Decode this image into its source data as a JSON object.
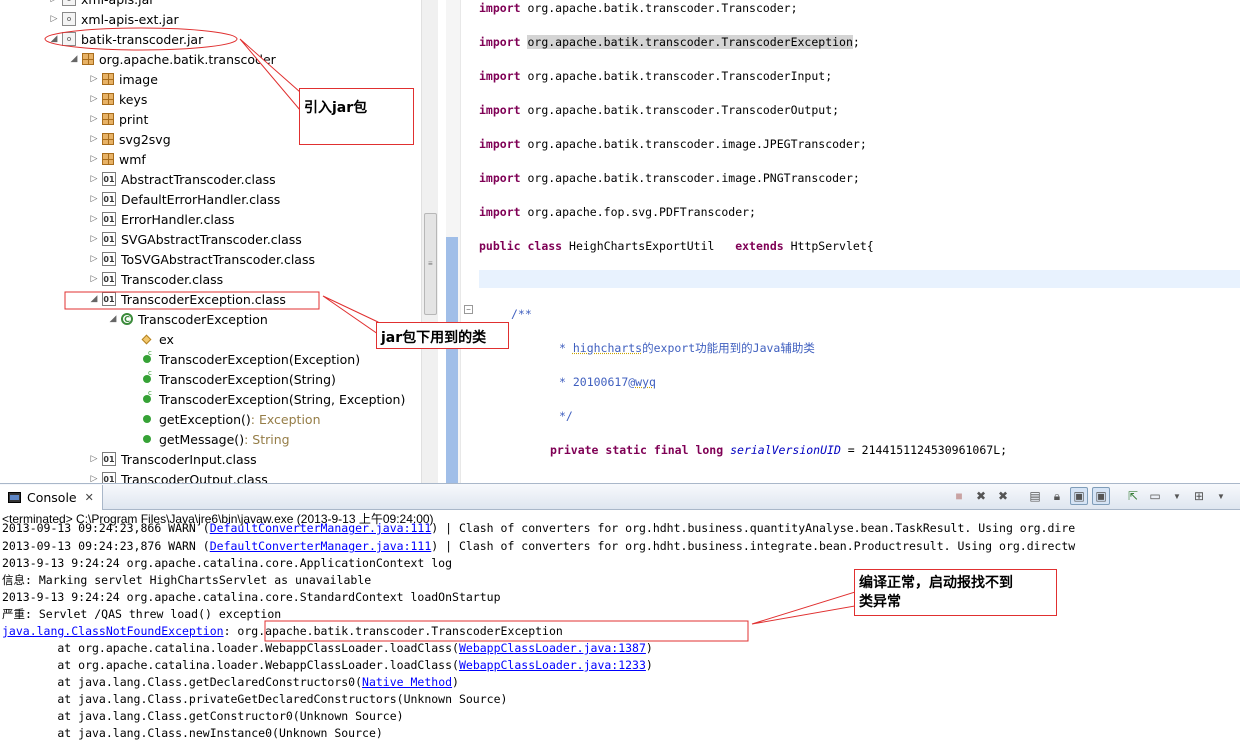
{
  "tree": {
    "items": [
      {
        "label": "xml-apis.jar",
        "icon": "jar-icon",
        "twisty": "▷"
      },
      {
        "label": "xml-apis-ext.jar",
        "icon": "jar-icon",
        "twisty": "▷"
      },
      {
        "label": "batik-transcoder.jar",
        "icon": "jar-icon",
        "twisty": "◢"
      },
      {
        "label": "org.apache.batik.transcoder",
        "icon": "package-icon",
        "twisty": "◢"
      },
      {
        "label": "image",
        "icon": "package-icon",
        "twisty": "▷"
      },
      {
        "label": "keys",
        "icon": "package-icon",
        "twisty": "▷"
      },
      {
        "label": "print",
        "icon": "package-icon",
        "twisty": "▷"
      },
      {
        "label": "svg2svg",
        "icon": "package-icon",
        "twisty": "▷"
      },
      {
        "label": "wmf",
        "icon": "package-icon",
        "twisty": "▷"
      },
      {
        "label": "AbstractTranscoder.class",
        "icon": "class-file-icon",
        "twisty": "▷"
      },
      {
        "label": "DefaultErrorHandler.class",
        "icon": "class-file-icon",
        "twisty": "▷"
      },
      {
        "label": "ErrorHandler.class",
        "icon": "class-file-icon",
        "twisty": "▷"
      },
      {
        "label": "SVGAbstractTranscoder.class",
        "icon": "class-file-icon",
        "twisty": "▷"
      },
      {
        "label": "ToSVGAbstractTranscoder.class",
        "icon": "class-file-icon",
        "twisty": "▷"
      },
      {
        "label": "Transcoder.class",
        "icon": "class-file-icon",
        "twisty": "▷"
      },
      {
        "label": "TranscoderException.class",
        "icon": "class-file-icon",
        "twisty": "◢"
      },
      {
        "label": "TranscoderException",
        "icon": "class-icon",
        "twisty": "◢"
      },
      {
        "label": "ex",
        "icon": "field-icon",
        "twisty": ""
      },
      {
        "label": "TranscoderException(Exception)",
        "icon": "constructor-icon",
        "twisty": ""
      },
      {
        "label": "TranscoderException(String)",
        "icon": "constructor-icon",
        "twisty": ""
      },
      {
        "label": "TranscoderException(String, Exception)",
        "icon": "constructor-icon",
        "twisty": ""
      },
      {
        "label": "getException()",
        "type": " : Exception",
        "icon": "method-icon",
        "twisty": ""
      },
      {
        "label": "getMessage()",
        "type": " : String",
        "icon": "method-icon",
        "twisty": ""
      },
      {
        "label": "TranscoderInput.class",
        "icon": "class-file-icon",
        "twisty": "▷"
      },
      {
        "label": "TranscoderOutput.class",
        "icon": "class-file-icon",
        "twisty": "▷"
      }
    ]
  },
  "editor": {
    "imports": [
      "org.apache.batik.transcoder.Transcoder;",
      "org.apache.batik.transcoder.TranscoderException",
      "org.apache.batik.transcoder.TranscoderInput;",
      "org.apache.batik.transcoder.TranscoderOutput;",
      "org.apache.batik.transcoder.image.JPEGTranscoder;",
      "org.apache.batik.transcoder.image.PNGTranscoder;",
      "org.apache.fop.svg.PDFTranscoder;"
    ],
    "kw_import": "import",
    "kw_public": "public",
    "kw_class": "class",
    "kw_extends": "extends",
    "kw_private": "private",
    "kw_static": "static",
    "kw_final": "final",
    "kw_long": "long",
    "class_name": " HeighChartsExportUtil   ",
    "superclass": " HttpServlet{",
    "semicolon": ";",
    "comment_open": "/**",
    "comment_star": "* ",
    "comment_line1_a": "highcharts",
    "comment_line1_b": "的export功能用到的Java辅助类",
    "comment_line2_a": "20100617@",
    "comment_line2_b": "wyq",
    "comment_close": "*/",
    "field_name": "serialVersionUID",
    "field_value": " = 2144151124530961067L;"
  },
  "console": {
    "tab_label": "Console",
    "close_glyph": "✕",
    "process": "<terminated> C:\\Program Files\\Java\\jre6\\bin\\javaw.exe (2013-9-13 上午09:24:00)",
    "line0_a": "2013-09-13 09:24:23,866 WARN (",
    "line0_link": "DefaultConverterManager.java:111",
    "line0_b": ") | Clash of converters for org.hdht.business.quantityAnalyse.bean.TaskResult. Using org.dire",
    "line1_a": "2013-09-13 09:24:23,876 WARN (",
    "line1_link": "DefaultConverterManager.java:111",
    "line1_b": ") | Clash of converters for org.hdht.business.integrate.bean.Productresult. Using org.directw",
    "line2": "2013-9-13 9:24:24 org.apache.catalina.core.ApplicationContext log",
    "line3": "信息: Marking servlet HighChartsServlet as unavailable",
    "line4": "2013-9-13 9:24:24 org.apache.catalina.core.StandardContext loadOnStartup",
    "line5": "严重: Servlet /QAS threw load() exception",
    "exc_link": "java.lang.ClassNotFoundException",
    "exc_sep": ": ",
    "exc_class": "org.apache.batik.transcoder.TranscoderException",
    "st1_a": "        at org.apache.catalina.loader.WebappClassLoader.loadClass(",
    "st1_link": "WebappClassLoader.java:1387",
    "st2_a": "        at org.apache.catalina.loader.WebappClassLoader.loadClass(",
    "st2_link": "WebappClassLoader.java:1233",
    "st3_a": "        at java.lang.Class.getDeclaredConstructors0(",
    "st3_link": "Native Method",
    "close_paren": ")",
    "st4": "        at java.lang.Class.privateGetDeclaredConstructors(Unknown Source)",
    "st5": "        at java.lang.Class.getConstructor0(Unknown Source)",
    "st6": "        at java.lang.Class.newInstance0(Unknown Source)"
  },
  "annotations": {
    "jar_note": "引入jar包",
    "class_note": "jar包下用到的类",
    "error_note_line1": "编译正常，启动报找不到",
    "error_note_line2": "类异常",
    "color": "#e03030"
  }
}
